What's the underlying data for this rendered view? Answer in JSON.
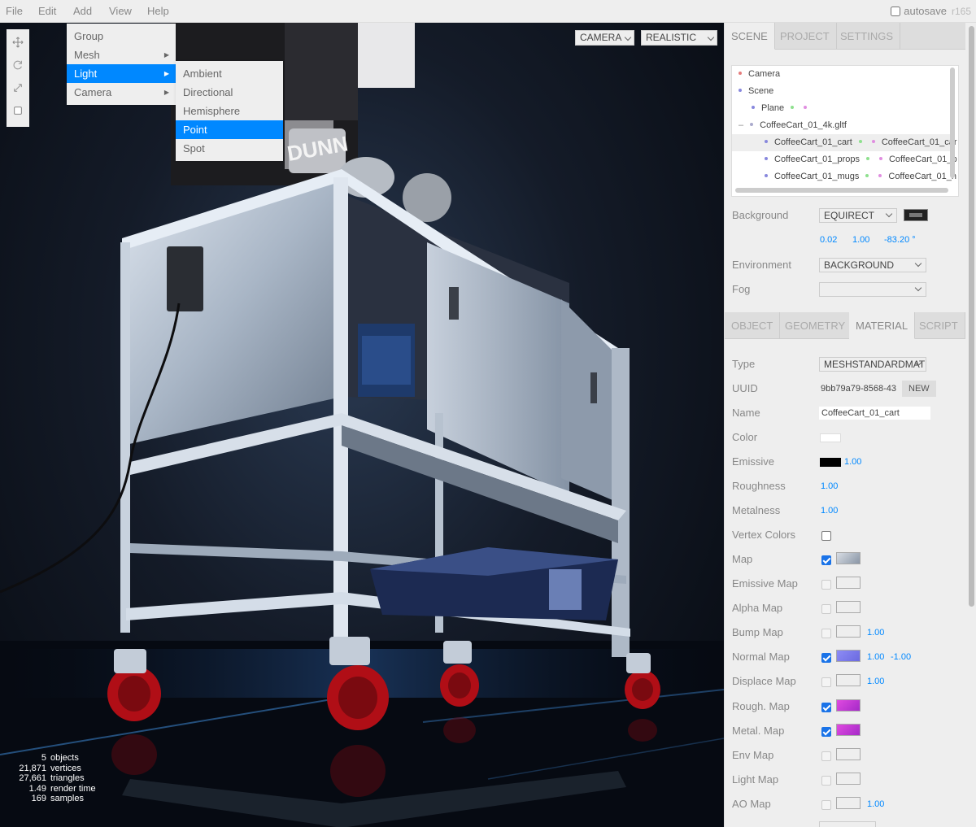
{
  "menubar": {
    "menus": [
      "File",
      "Edit",
      "Add",
      "View",
      "Help"
    ],
    "autosave_label": "autosave",
    "autosave_checked": false,
    "revision": "r165"
  },
  "add_menu": {
    "items": [
      {
        "label": "Group",
        "submenu": false
      },
      {
        "label": "Mesh",
        "submenu": true
      },
      {
        "label": "Light",
        "submenu": true,
        "active": true
      },
      {
        "label": "Camera",
        "submenu": true
      }
    ],
    "light_submenu": [
      "Ambient",
      "Directional",
      "Hemisphere",
      "Point",
      "Spot"
    ],
    "light_submenu_active": "Point"
  },
  "viewport": {
    "camera_select": "CAMERA",
    "shading_select": "REALISTIC",
    "toolbar_icons": [
      "translate-icon",
      "rotate-icon",
      "scale-icon",
      "local-space-icon"
    ],
    "info": [
      {
        "value": "5",
        "label": "objects"
      },
      {
        "value": "21,871",
        "label": "vertices"
      },
      {
        "value": "27,661",
        "label": "triangles"
      },
      {
        "value": "1.49",
        "label": "render time"
      },
      {
        "value": "169",
        "label": "samples"
      }
    ],
    "scene_text": "DUNN"
  },
  "sidebar": {
    "top_tabs": [
      "SCENE",
      "PROJECT",
      "SETTINGS"
    ],
    "top_tab_selected": "SCENE",
    "outliner": [
      {
        "label": "Camera",
        "dot": "#e57c7c",
        "dots_after": []
      },
      {
        "label": "Scene",
        "dot": "#8888dd",
        "dots_after": []
      },
      {
        "label": "Plane",
        "dot": "#8888dd",
        "dots_after": [
          "#8ee08e",
          "#e08ee0"
        ]
      },
      {
        "label": "CoffeeCart_01_4k.gltf",
        "dot": "#aaaacc",
        "dots_after": []
      },
      {
        "label": "CoffeeCart_01_cart",
        "dot": "#8888dd",
        "dots_after": [
          "#8ee08e",
          "#e08ee0"
        ],
        "second": "CoffeeCart_01_car"
      },
      {
        "label": "CoffeeCart_01_props",
        "dot": "#8888dd",
        "dots_after": [
          "#8ee08e",
          "#e08ee0"
        ],
        "second": "CoffeeCart_01_p"
      },
      {
        "label": "CoffeeCart_01_mugs",
        "dot": "#8888dd",
        "dots_after": [
          "#8ee08e",
          "#e08ee0"
        ],
        "second": "CoffeeCart_01_n"
      }
    ],
    "scene_props": {
      "background_label": "Background",
      "background_value": "EQUIRECT",
      "background_numbers": [
        "0.02",
        "1.00",
        "-83.20 °"
      ],
      "environment_label": "Environment",
      "environment_value": "BACKGROUND",
      "fog_label": "Fog",
      "fog_value": ""
    },
    "object_tabs": [
      "OBJECT",
      "GEOMETRY",
      "MATERIAL",
      "SCRIPT"
    ],
    "object_tab_selected": "MATERIAL",
    "material": {
      "type_label": "Type",
      "type_value": "MESHSTANDARDMATI",
      "uuid_label": "UUID",
      "uuid_value": "9bb79a79-8568-43",
      "uuid_button": "NEW",
      "name_label": "Name",
      "name_value": "CoffeeCart_01_cart",
      "color_label": "Color",
      "emissive_label": "Emissive",
      "emissive_value": "1.00",
      "roughness_label": "Roughness",
      "roughness_value": "1.00",
      "metalness_label": "Metalness",
      "metalness_value": "1.00",
      "vertex_colors_label": "Vertex Colors",
      "maps": [
        {
          "label": "Map",
          "checked": true,
          "thumb": "texture",
          "values": []
        },
        {
          "label": "Emissive Map",
          "checked": false,
          "thumb": "empty",
          "values": []
        },
        {
          "label": "Alpha Map",
          "checked": false,
          "thumb": "empty",
          "values": []
        },
        {
          "label": "Bump Map",
          "checked": false,
          "thumb": "empty",
          "values": [
            "1.00"
          ]
        },
        {
          "label": "Normal Map",
          "checked": true,
          "thumb": "normal",
          "values": [
            "1.00",
            "-1.00"
          ]
        },
        {
          "label": "Displace Map",
          "checked": false,
          "thumb": "empty",
          "values": [
            "1.00"
          ]
        },
        {
          "label": "Rough. Map",
          "checked": true,
          "thumb": "magenta",
          "values": []
        },
        {
          "label": "Metal. Map",
          "checked": true,
          "thumb": "magenta",
          "values": []
        },
        {
          "label": "Env Map",
          "checked": false,
          "thumb": "empty",
          "values": []
        },
        {
          "label": "Light Map",
          "checked": false,
          "thumb": "empty",
          "values": []
        },
        {
          "label": "AO Map",
          "checked": false,
          "thumb": "empty",
          "values": [
            "1.00"
          ]
        }
      ]
    }
  },
  "colors": {
    "accent": "#0088ff",
    "panel": "#eeeeee",
    "checkbox_checked": "#1a73e8"
  }
}
